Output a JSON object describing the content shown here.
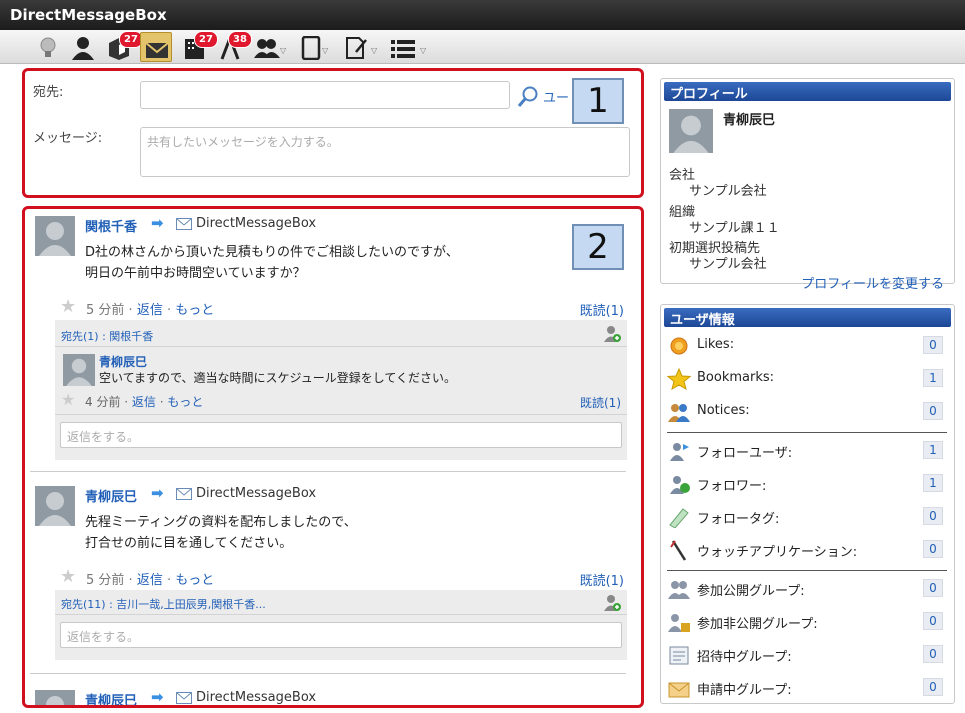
{
  "window_title": "DirectMessageBox",
  "toolbar": {
    "badges": {
      "timeline": "27",
      "company": "27",
      "app": "38"
    }
  },
  "compose": {
    "to_label": "宛先:",
    "to_value": "",
    "user_link": "ユー",
    "message_label": "メッセージ:",
    "message_placeholder": "共有したいメッセージを入力する。"
  },
  "callouts": {
    "one": "1",
    "two": "2"
  },
  "posts": [
    {
      "author": "関根千香",
      "destination": "DirectMessageBox",
      "body_line1": "D社の林さんから頂いた見積もりの件でご相談したいのですが、",
      "body_line2": "明日の午前中お時間空いていますか？",
      "time": "5 分前",
      "reply": "返信",
      "more": "もっと",
      "read": "既読(1)",
      "to_line": "宛先(1) : 関根千香",
      "reply_author": "青柳辰巳",
      "reply_body": "空いてますので、適当な時間にスケジュール登録をしてください。",
      "reply_time": "4 分前",
      "reply_reply": "返信",
      "reply_more": "もっと",
      "reply_read": "既読(1)",
      "reply_placeholder": "返信をする。"
    },
    {
      "author": "青柳辰巳",
      "destination": "DirectMessageBox",
      "body_line1": "先程ミーティングの資料を配布しましたので、",
      "body_line2": "打合せの前に目を通してください。",
      "time": "5 分前",
      "reply": "返信",
      "more": "もっと",
      "read": "既読(1)",
      "to_line": "宛先(11) : 吉川一哉,上田辰男,関根千香...",
      "reply_placeholder": "返信をする。"
    },
    {
      "author": "青柳辰巳",
      "destination": "DirectMessageBox"
    }
  ],
  "profile": {
    "header": "プロフィール",
    "name": "青柳辰巳",
    "company_label": "会社",
    "company": "サンプル会社",
    "org_label": "組織",
    "org": "サンプル課１１",
    "default_post_label": "初期選択投稿先",
    "default_post": "サンプル会社",
    "edit_link": "プロフィールを変更する"
  },
  "user_info": {
    "header": "ユーザ情報",
    "rows": [
      {
        "label": "Likes:",
        "count": "0"
      },
      {
        "label": "Bookmarks:",
        "count": "1"
      },
      {
        "label": "Notices:",
        "count": "0"
      },
      {
        "label": "フォローユーザ:",
        "count": "1"
      },
      {
        "label": "フォロワー:",
        "count": "1"
      },
      {
        "label": "フォロータグ:",
        "count": "0"
      },
      {
        "label": "ウォッチアプリケーション:",
        "count": "0"
      },
      {
        "label": "参加公開グループ:",
        "count": "0"
      },
      {
        "label": "参加非公開グループ:",
        "count": "0"
      },
      {
        "label": "招待中グループ:",
        "count": "0"
      },
      {
        "label": "申請中グループ:",
        "count": "0"
      }
    ]
  }
}
